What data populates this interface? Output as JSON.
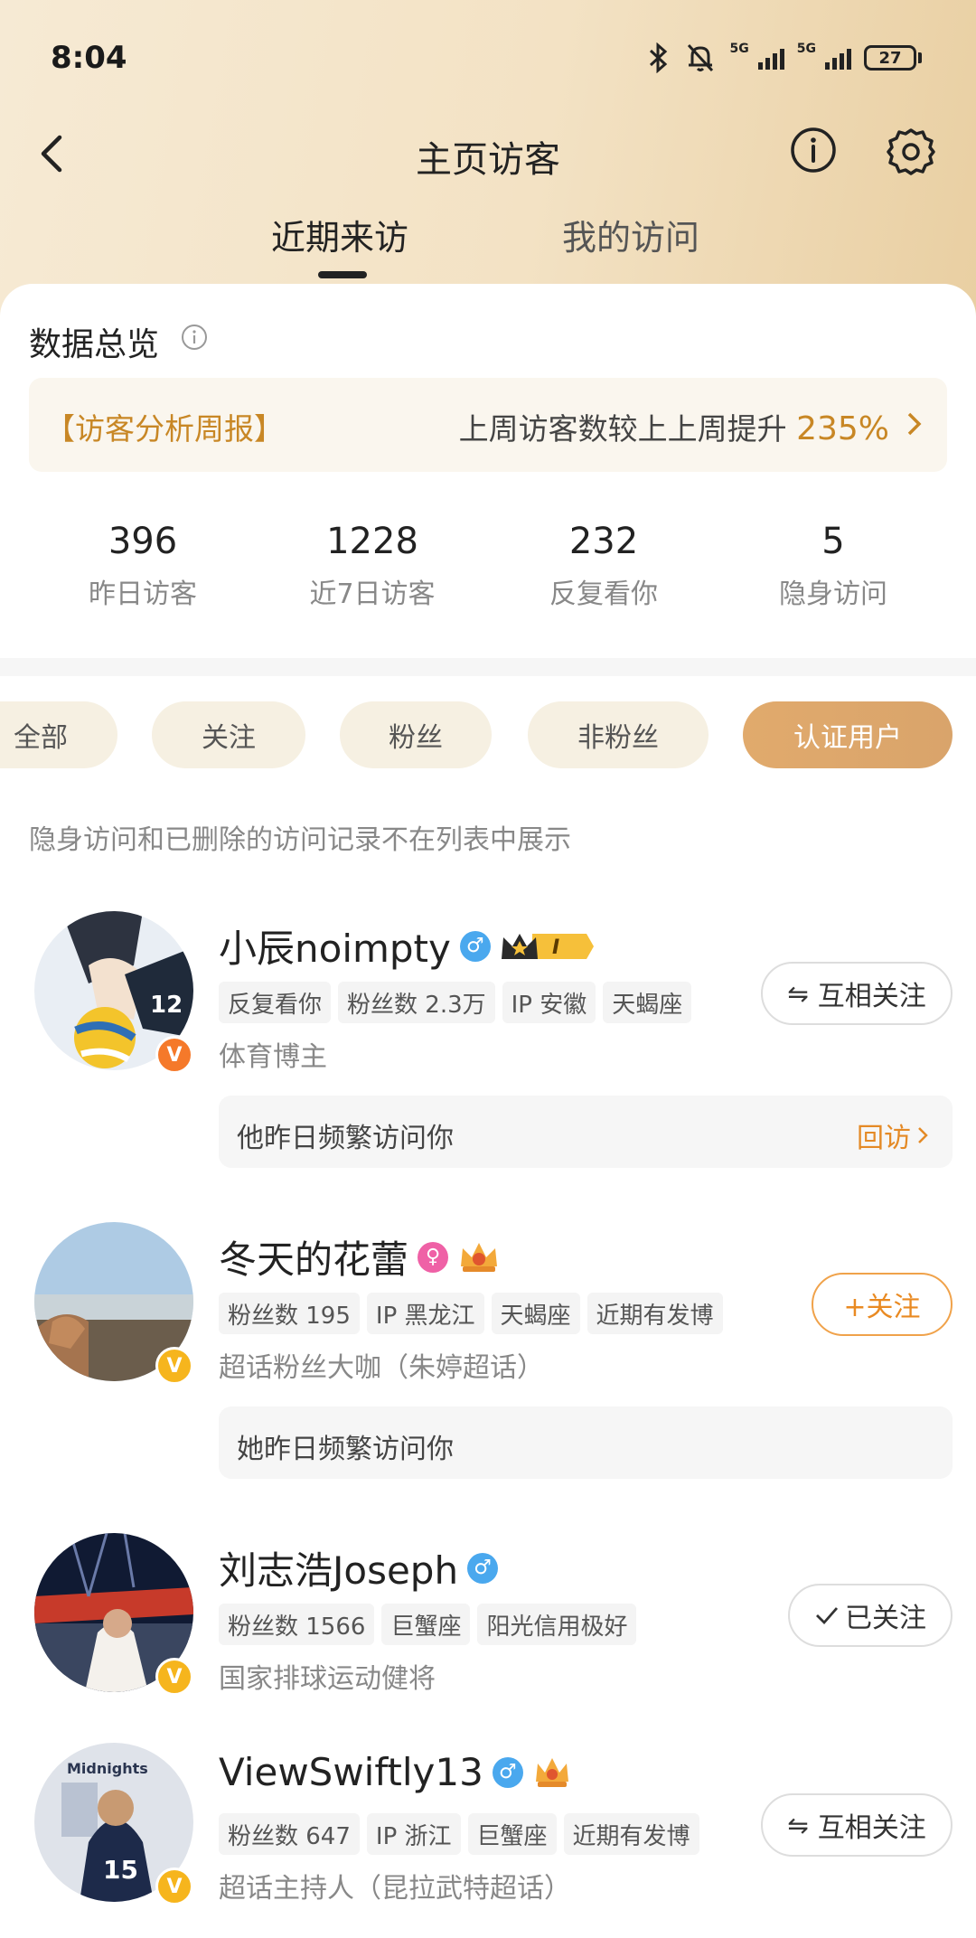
{
  "status_bar": {
    "time": "8:04",
    "network_1": "5G",
    "network_2": "5G",
    "battery": "27"
  },
  "nav": {
    "title": "主页访客"
  },
  "tabs": [
    {
      "label": "近期来访"
    },
    {
      "label": "我的访问"
    }
  ],
  "overview": {
    "title": "数据总览",
    "report_label": "【访客分析周报】",
    "report_text": "上周访客数较上上周提升",
    "report_percent": "235%",
    "stats": [
      {
        "value": "396",
        "label": "昨日访客"
      },
      {
        "value": "1228",
        "label": "近7日访客"
      },
      {
        "value": "232",
        "label": "反复看你"
      },
      {
        "value": "5",
        "label": "隐身访问"
      }
    ]
  },
  "filters": [
    "全部",
    "关注",
    "粉丝",
    "非粉丝",
    "认证用户"
  ],
  "note": "隐身访问和已删除的访问记录不在列表中展示",
  "users": [
    {
      "name": "小辰noimpty",
      "badge_level": "I",
      "tags": [
        "反复看你",
        "粉丝数 2.3万",
        "IP 安徽",
        "天蝎座"
      ],
      "desc": "体育博主",
      "follow_label": "互相关注",
      "visit_text": "他昨日频繁访问你",
      "revisit_label": "回访"
    },
    {
      "name": "冬天的花蕾",
      "tags": [
        "粉丝数 195",
        "IP 黑龙江",
        "天蝎座",
        "近期有发博"
      ],
      "desc": "超话粉丝大咖（朱婷超话）",
      "follow_label": "+关注",
      "visit_text": "她昨日频繁访问你"
    },
    {
      "name": "刘志浩Joseph",
      "tags": [
        "粉丝数 1566",
        "巨蟹座",
        "阳光信用极好"
      ],
      "desc": "国家排球运动健将",
      "follow_label": "已关注"
    },
    {
      "name": "ViewSwiftly13",
      "tags": [
        "粉丝数 647",
        "IP 浙江",
        "巨蟹座",
        "近期有发博"
      ],
      "desc": "超话主持人（昆拉武特超话）",
      "follow_label": "互相关注",
      "avatar_text": "Midnights",
      "avatar_jersey": "15"
    }
  ],
  "colors": {
    "accent": "#e48a26",
    "chip_active": "#dea76b",
    "male": "#4aa8ee",
    "female": "#ef61a6"
  }
}
